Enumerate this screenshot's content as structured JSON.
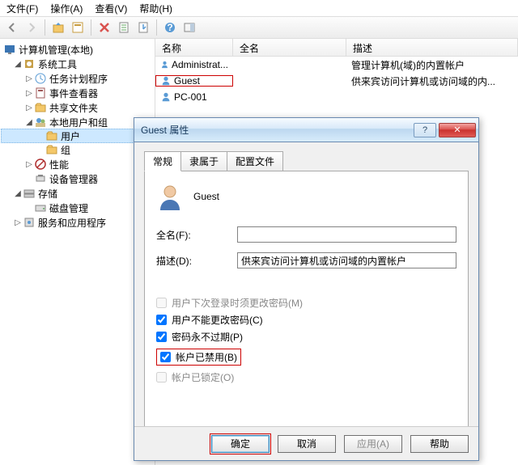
{
  "menu": {
    "file": "文件(F)",
    "action": "操作(A)",
    "view": "查看(V)",
    "help": "帮助(H)"
  },
  "tree": {
    "root": "计算机管理(本地)",
    "systools": "系统工具",
    "task": "任务计划程序",
    "event": "事件查看器",
    "shared": "共享文件夹",
    "localug": "本地用户和组",
    "users": "用户",
    "groups": "组",
    "perf": "性能",
    "devmgr": "设备管理器",
    "storage": "存储",
    "disk": "磁盘管理",
    "services": "服务和应用程序"
  },
  "list": {
    "headers": {
      "name": "名称",
      "full": "全名",
      "desc": "描述"
    },
    "rows": [
      {
        "name": "Administrat...",
        "full": "",
        "desc": "管理计算机(域)的内置帐户"
      },
      {
        "name": "Guest",
        "full": "",
        "desc": "供来宾访问计算机或访问域的内..."
      },
      {
        "name": "PC-001",
        "full": "",
        "desc": ""
      }
    ]
  },
  "dialog": {
    "title": "Guest 属性",
    "tabs": {
      "general": "常规",
      "member": "隶属于",
      "profile": "配置文件"
    },
    "username": "Guest",
    "fullname_label": "全名(F):",
    "fullname_value": "",
    "desc_label": "描述(D):",
    "desc_value": "供来宾访问计算机或访问域的内置帐户",
    "chk_mustchange": "用户下次登录时须更改密码(M)",
    "chk_cannot": "用户不能更改密码(C)",
    "chk_never": "密码永不过期(P)",
    "chk_disabled": "帐户已禁用(B)",
    "chk_locked": "帐户已锁定(O)",
    "buttons": {
      "ok": "确定",
      "cancel": "取消",
      "apply": "应用(A)",
      "help": "帮助"
    }
  }
}
